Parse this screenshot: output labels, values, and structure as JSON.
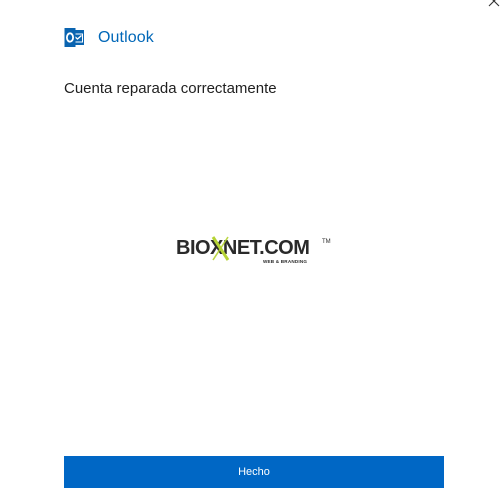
{
  "window": {
    "close_icon": "close-icon"
  },
  "header": {
    "app_name": "Outlook",
    "logo_icon": "outlook-logo-icon",
    "accent_color": "#0067b8"
  },
  "main": {
    "status_message": "Cuenta reparada correctamente"
  },
  "brand": {
    "name": "BIOXNET.COM",
    "trademark": "TM",
    "tagline": "WEB & BRANDING",
    "accent_color": "#b5d334"
  },
  "footer": {
    "done_label": "Hecho",
    "button_color": "#0067c5"
  }
}
